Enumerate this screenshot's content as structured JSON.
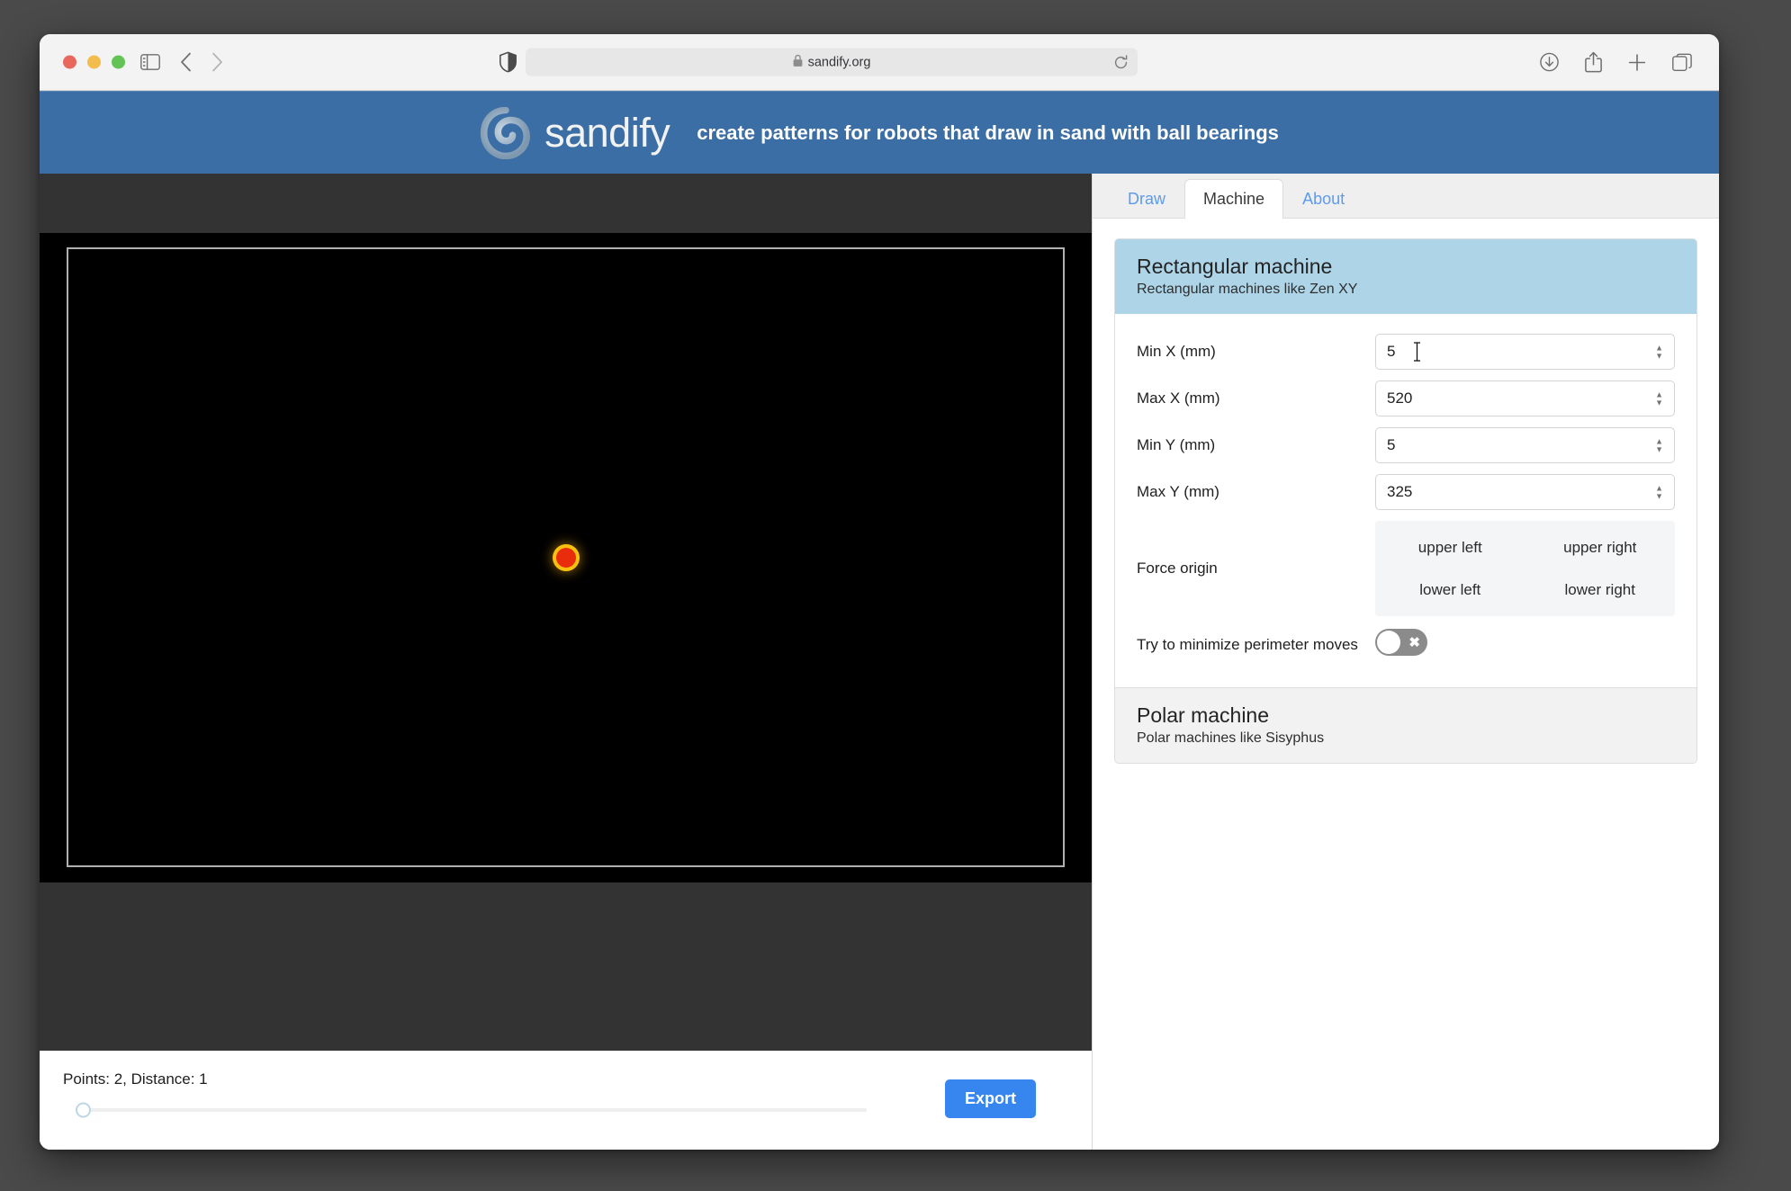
{
  "browser": {
    "url": "sandify.org",
    "lock_icon": "lock-icon",
    "traffic_lights": [
      "close",
      "minimize",
      "zoom"
    ],
    "toolbar_icons": [
      "sidebar-icon",
      "back-icon",
      "forward-icon",
      "shield-icon",
      "reload-icon",
      "downloads-icon",
      "share-icon",
      "new-tab-icon",
      "tab-overview-icon"
    ]
  },
  "header": {
    "brand": "sandify",
    "tagline": "create patterns for robots that draw in sand with ball bearings",
    "brand_color": "#3b6ea5"
  },
  "panel": {
    "tabs": [
      {
        "label": "Draw",
        "active": false
      },
      {
        "label": "Machine",
        "active": true
      },
      {
        "label": "About",
        "active": false
      }
    ],
    "rectangular": {
      "title": "Rectangular machine",
      "subtitle": "Rectangular machines like Zen XY",
      "open": true,
      "fields": [
        {
          "label": "Min X (mm)",
          "value": "5"
        },
        {
          "label": "Max X (mm)",
          "value": "520"
        },
        {
          "label": "Min Y (mm)",
          "value": "5"
        },
        {
          "label": "Max Y (mm)",
          "value": "325"
        }
      ],
      "force_origin": {
        "label": "Force origin",
        "options": [
          "upper left",
          "upper right",
          "lower left",
          "lower right"
        ]
      },
      "minimize_perimeter": {
        "label": "Try to minimize perimeter moves",
        "enabled": false,
        "off_glyph": "✖"
      }
    },
    "polar": {
      "title": "Polar machine",
      "subtitle": "Polar machines like Sisyphus",
      "open": false
    }
  },
  "canvas": {
    "stats": "Points: 2, Distance: 1",
    "export_label": "Export",
    "slider_value": 0,
    "background": "#000000",
    "machine_border_color": "#b0b0b0",
    "dot_fill": "#e82c0c",
    "dot_glow": "#f9c010"
  }
}
